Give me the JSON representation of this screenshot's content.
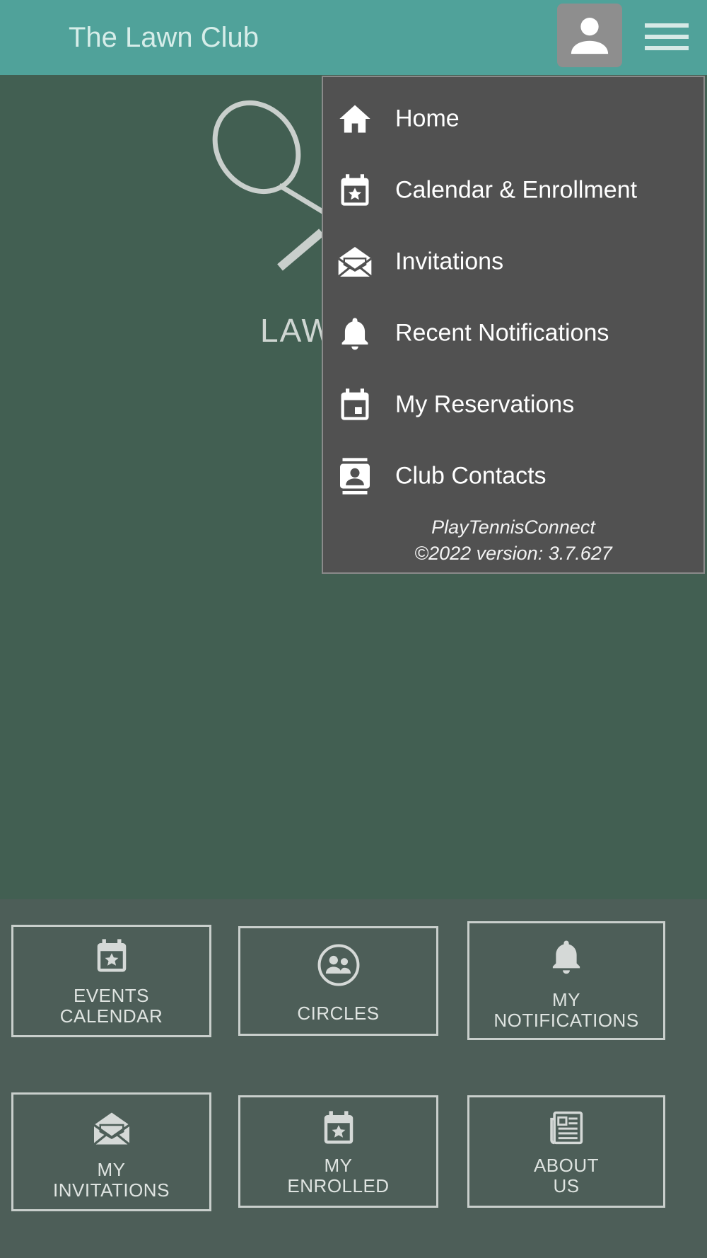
{
  "header": {
    "title": "The Lawn Club",
    "avatar_icon": "person-icon",
    "menu_icon": "hamburger-icon",
    "background": "#50a29a"
  },
  "hero": {
    "logo_text": "LAW"
  },
  "menu": {
    "items": [
      {
        "label": "Home",
        "icon": "home-icon"
      },
      {
        "label": "Calendar & Enrollment",
        "icon": "calendar-star-icon"
      },
      {
        "label": "Invitations",
        "icon": "open-envelope-icon"
      },
      {
        "label": "Recent Notifications",
        "icon": "bell-icon"
      },
      {
        "label": "My Reservations",
        "icon": "calendar-event-icon"
      },
      {
        "label": "Club Contacts",
        "icon": "contact-card-icon"
      }
    ],
    "footer_line1": "PlayTennisConnect",
    "footer_line2": "©2022 version: 3.7.627",
    "background": "#515151"
  },
  "tiles": [
    {
      "line1": "EVENTS",
      "line2": "CALENDAR",
      "icon": "calendar-star-icon"
    },
    {
      "line1": "CIRCLES",
      "line2": "",
      "icon": "group-icon"
    },
    {
      "line1": "MY",
      "line2": "NOTIFICATIONS",
      "icon": "bell-icon"
    },
    {
      "line1": "MY",
      "line2": "INVITATIONS",
      "icon": "open-envelope-icon"
    },
    {
      "line1": "MY",
      "line2": "ENROLLED",
      "icon": "calendar-star-icon"
    },
    {
      "line1": "ABOUT",
      "line2": "US",
      "icon": "newspaper-icon"
    }
  ]
}
